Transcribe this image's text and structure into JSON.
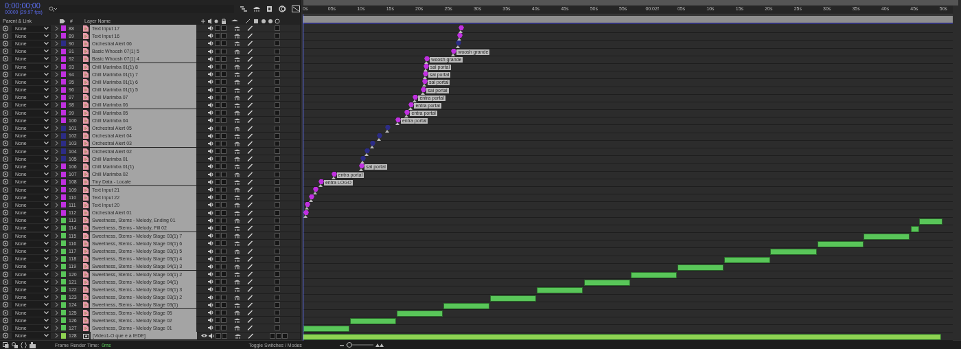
{
  "header": {
    "timecode": "0;00;00;00",
    "frame_info": "00000 (29.97 fps)"
  },
  "columns": {
    "parent": "Parent & Link",
    "number": "#",
    "name": "Layer Name"
  },
  "ruler": [
    "0s",
    "05s",
    "10s",
    "15s",
    "20s",
    "25s",
    "30s",
    "35s",
    "40s",
    "45s",
    "50s",
    "55s",
    "00:02f",
    "05s",
    "10s",
    "15s",
    "20s",
    "25s",
    "30s",
    "35s",
    "40s",
    "45s",
    "50s"
  ],
  "layers": [
    {
      "number": "88",
      "name": "Text Input 17",
      "parent": "None",
      "color": "#c030e0",
      "kind": "marker"
    },
    {
      "number": "89",
      "name": "Text Input 16",
      "parent": "None",
      "color": "#c030e0",
      "kind": "marker"
    },
    {
      "number": "90",
      "name": "Orchestral Alert 06",
      "parent": "None",
      "color": "#2c2c86",
      "kind": "marker"
    },
    {
      "number": "91",
      "name": "Basic Whoosh 07(1) 5",
      "parent": "None",
      "color": "#c030e0",
      "kind": "marker",
      "comment": "woosh grande"
    },
    {
      "number": "92",
      "name": "Basic Whoosh 07(1) 4",
      "parent": "None",
      "color": "#c030e0",
      "kind": "marker",
      "comment": "woosh grande"
    },
    {
      "number": "93",
      "name": "Chill Marimba 01(1) 8",
      "parent": "None",
      "color": "#c030e0",
      "kind": "marker",
      "comment": "sai portal"
    },
    {
      "number": "94",
      "name": "Chill Marimba 01(1) 7",
      "parent": "None",
      "color": "#c030e0",
      "kind": "marker",
      "comment": "sai portal"
    },
    {
      "number": "95",
      "name": "Chill Marimba 01(1) 6",
      "parent": "None",
      "color": "#c030e0",
      "kind": "marker",
      "comment": "sai portal"
    },
    {
      "number": "96",
      "name": "Chill Marimba 01(1) 5",
      "parent": "None",
      "color": "#c030e0",
      "kind": "marker",
      "comment": "sai portal"
    },
    {
      "number": "97",
      "name": "Chill Marimba 07",
      "parent": "None",
      "color": "#c030e0",
      "kind": "marker",
      "comment": "entra portal"
    },
    {
      "number": "98",
      "name": "Chill Marimba 06",
      "parent": "None",
      "color": "#c030e0",
      "kind": "marker",
      "comment": "entra portal"
    },
    {
      "number": "99",
      "name": "Chill Marimba 05",
      "parent": "None",
      "color": "#c030e0",
      "kind": "marker",
      "comment": "entra portal"
    },
    {
      "number": "100",
      "name": "Chill Marimba 04",
      "parent": "None",
      "color": "#c030e0",
      "kind": "marker",
      "comment": "entra portal"
    },
    {
      "number": "101",
      "name": "Orchestral Alert 05",
      "parent": "None",
      "color": "#2c2c86",
      "kind": "marker"
    },
    {
      "number": "102",
      "name": "Orchestral Alert 04",
      "parent": "None",
      "color": "#2c2c86",
      "kind": "marker"
    },
    {
      "number": "103",
      "name": "Orchestral Alert 03",
      "parent": "None",
      "color": "#2c2c86",
      "kind": "marker"
    },
    {
      "number": "104",
      "name": "Orchestral Alert 02",
      "parent": "None",
      "color": "#2c2c86",
      "kind": "marker"
    },
    {
      "number": "105",
      "name": "Chill Marimba 01",
      "parent": "None",
      "color": "#2c2c86",
      "kind": "marker"
    },
    {
      "number": "106",
      "name": "Chill Marimba 01(1)",
      "parent": "None",
      "color": "#c030e0",
      "kind": "marker",
      "comment": "sai portal"
    },
    {
      "number": "107",
      "name": "Chill Marimba 02",
      "parent": "None",
      "color": "#c030e0",
      "kind": "marker",
      "comment": "entra portal"
    },
    {
      "number": "108",
      "name": "Tiny Data - Locate",
      "parent": "None",
      "color": "#c030e0",
      "kind": "marker",
      "comment": "entra LOGO"
    },
    {
      "number": "109",
      "name": "Text Input 21",
      "parent": "None",
      "color": "#c030e0",
      "kind": "marker"
    },
    {
      "number": "110",
      "name": "Text Input 22",
      "parent": "None",
      "color": "#c030e0",
      "kind": "marker"
    },
    {
      "number": "111",
      "name": "Text Input 20",
      "parent": "None",
      "color": "#c030e0",
      "kind": "marker"
    },
    {
      "number": "112",
      "name": "Orchestral Alert 01",
      "parent": "None",
      "color": "#c030e0",
      "kind": "marker"
    },
    {
      "number": "113",
      "name": "Sweetness, Stems - Melody, Ending 01",
      "parent": "None",
      "color": "#59c659",
      "kind": "clip"
    },
    {
      "number": "114",
      "name": "Sweetness, Stems - Melody, Fill 02",
      "parent": "None",
      "color": "#59c659",
      "kind": "clip"
    },
    {
      "number": "115",
      "name": "Sweetness, Stems - Melody Stage 03(1) 7",
      "parent": "None",
      "color": "#59c659",
      "kind": "clip"
    },
    {
      "number": "116",
      "name": "Sweetness, Stems - Melody Stage 03(1) 6",
      "parent": "None",
      "color": "#59c659",
      "kind": "clip"
    },
    {
      "number": "117",
      "name": "Sweetness, Stems - Melody Stage 03(1) 5",
      "parent": "None",
      "color": "#59c659",
      "kind": "clip"
    },
    {
      "number": "118",
      "name": "Sweetness, Stems - Melody Stage 03(1) 4",
      "parent": "None",
      "color": "#59c659",
      "kind": "clip"
    },
    {
      "number": "119",
      "name": "Sweetness, Stems - Melody Stage 04(1) 3",
      "parent": "None",
      "color": "#59c659",
      "kind": "clip"
    },
    {
      "number": "120",
      "name": "Sweetness, Stems - Melody Stage 04(1) 2",
      "parent": "None",
      "color": "#59c659",
      "kind": "clip"
    },
    {
      "number": "121",
      "name": "Sweetness, Stems - Melody Stage 04(1)",
      "parent": "None",
      "color": "#59c659",
      "kind": "clip"
    },
    {
      "number": "122",
      "name": "Sweetness, Stems - Melody Stage 03(1) 3",
      "parent": "None",
      "color": "#59c659",
      "kind": "clip"
    },
    {
      "number": "123",
      "name": "Sweetness, Stems - Melody Stage 03(1) 2",
      "parent": "None",
      "color": "#59c659",
      "kind": "clip"
    },
    {
      "number": "124",
      "name": "Sweetness, Stems - Melody Stage 03(1)",
      "parent": "None",
      "color": "#59c659",
      "kind": "clip"
    },
    {
      "number": "125",
      "name": "Sweetness, Stems - Melody Stage 05",
      "parent": "None",
      "color": "#59c659",
      "kind": "clip"
    },
    {
      "number": "126",
      "name": "Sweetness, Stems - Melody Stage 02",
      "parent": "None",
      "color": "#59c659",
      "kind": "clip"
    },
    {
      "number": "127",
      "name": "Sweetness, Stems - Melody Stage 01",
      "parent": "None",
      "color": "#59c659",
      "kind": "clip"
    },
    {
      "number": "128",
      "name": "[Video1-O que e a IEDE]",
      "parent": "None",
      "color": "#8ed352",
      "kind": "video"
    }
  ],
  "status_bar": {
    "render_label": "Frame Render Time:",
    "render_time": "0ms",
    "toggle": "Toggle Switches / Modes",
    "zoom": {
      "level": 0.12
    }
  }
}
